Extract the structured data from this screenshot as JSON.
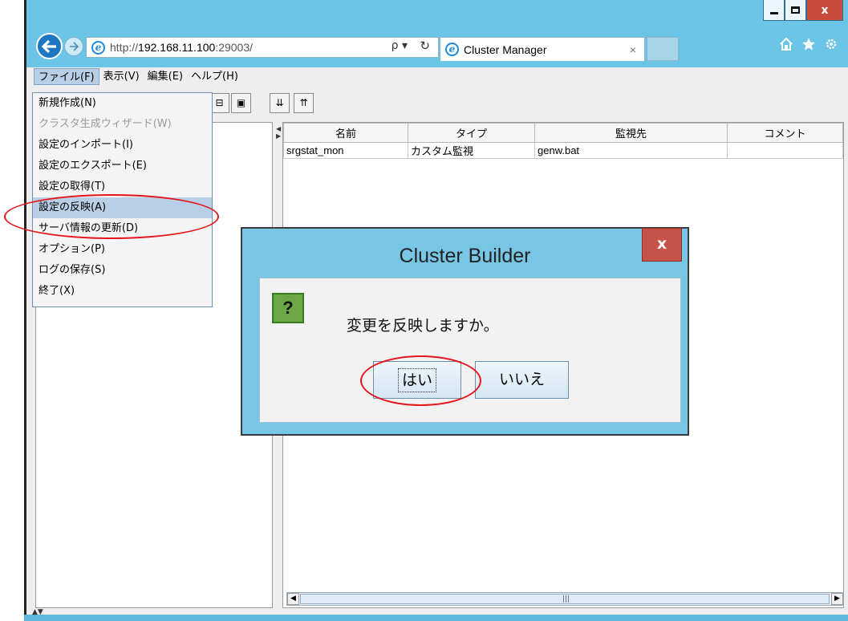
{
  "browser": {
    "url_prefix": "http://",
    "url_host": "192.168.11.100",
    "url_rest": ":29003/",
    "search_glyph": "ρ ▾",
    "refresh_glyph": "↻",
    "tab_title": "Cluster Manager",
    "tab_close": "×",
    "icons": [
      "home-icon",
      "star-icon",
      "gear-icon"
    ]
  },
  "window_controls": {
    "close": "x"
  },
  "menubar": {
    "items": [
      "ファイル(F)",
      "表示(V)",
      "編集(E)",
      "ヘルプ(H)"
    ]
  },
  "file_menu": {
    "items": [
      {
        "label": "新規作成(N)",
        "disabled": false
      },
      {
        "label": "クラスタ生成ウィザード(W)",
        "disabled": true
      },
      {
        "label": "設定のインポート(I)",
        "disabled": false
      },
      {
        "label": "設定のエクスポート(E)",
        "disabled": false
      },
      {
        "label": "設定の取得(T)",
        "disabled": false
      },
      {
        "label": "設定の反映(A)",
        "disabled": false,
        "highlighted": true
      },
      {
        "label": "サーバ情報の更新(D)",
        "disabled": false
      },
      {
        "label": "オプション(P)",
        "disabled": false
      },
      {
        "label": "ログの保存(S)",
        "disabled": false
      },
      {
        "label": "終了(X)",
        "disabled": false
      }
    ]
  },
  "table": {
    "columns": [
      "名前",
      "タイプ",
      "監視先",
      "コメント"
    ],
    "rows": [
      [
        "srgstat_mon",
        "カスタム監視",
        "genw.bat",
        ""
      ]
    ]
  },
  "dialog": {
    "title": "Cluster Builder",
    "close": "x",
    "icon_glyph": "?",
    "message": "変更を反映しますか。",
    "yes_label": "はい",
    "no_label": "いいえ"
  },
  "colors": {
    "window_frame": "#6cc4e6",
    "dialog_close": "#c75348",
    "highlight_ring": "#e8141c",
    "menu_highlight": "#b8cfe5"
  }
}
